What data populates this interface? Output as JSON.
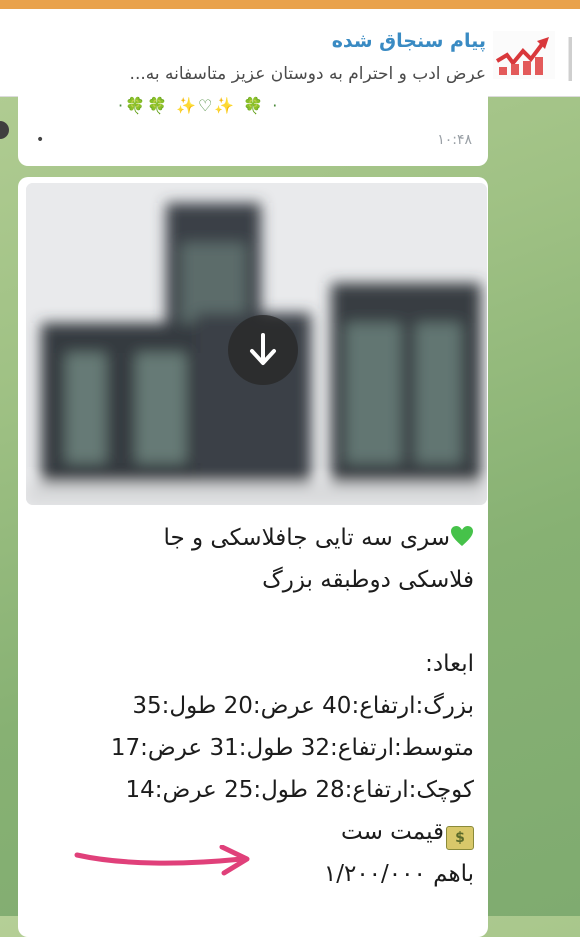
{
  "pinned": {
    "title": "پیام سنجاق شده",
    "preview": "عرض ادب و احترام به دوستان عزیز   متاسفانه به..."
  },
  "previous_message": {
    "emoji_row": "·🍀🍀 ✨♡✨ 🍀 ·",
    "time": "۱۰:۴۸",
    "dot": "•"
  },
  "message": {
    "title_line1": "سری سه تایی جافلاسکی و جا",
    "title_line2": "فلاسکی دوطبقه بزرگ",
    "dims_label": "ابعاد:",
    "size_large": "بزرگ:ارتفاع:40 عرض:20 طول:35",
    "size_medium": "متوسط:ارتفاع:32 طول:31 عرض:17",
    "size_small": "کوچک:ارتفاع:28 طول:25 عرض:14",
    "price_label": "قیمت ست",
    "price_value": "باهم ۱/۲۰۰/۰۰۰",
    "money_glyph": "$"
  },
  "colors": {
    "accent_blue": "#3a8bc3",
    "top_orange": "#e9a24c",
    "arrow_pink": "#e0407a",
    "heart_green": "#46c24a"
  },
  "icons": {
    "download": "download-arrow-icon",
    "heart": "green-heart-icon",
    "money": "money-bag-icon"
  }
}
